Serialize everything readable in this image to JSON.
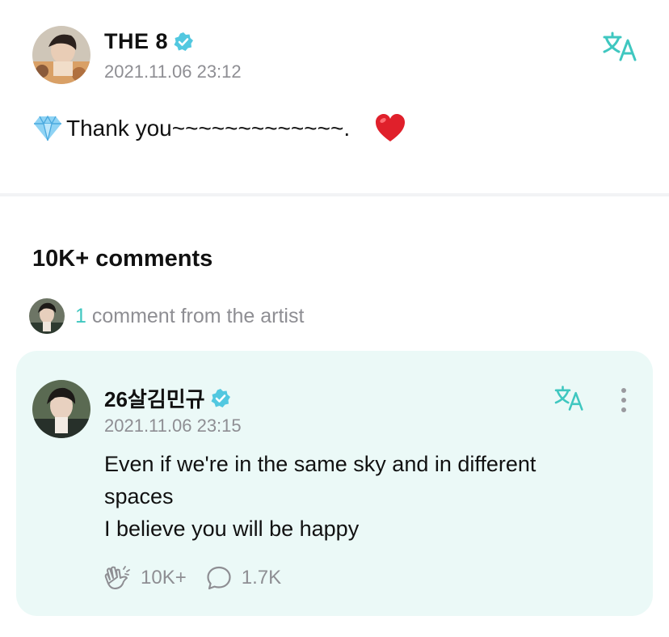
{
  "post": {
    "author": "THE 8",
    "timestamp": "2021.11.06 23:12",
    "text": "Thank you~~~~~~~~~~~~~.",
    "leading_emoji": "gem-stone",
    "trailing_emoji": "red-heart"
  },
  "comments_section": {
    "count_label": "10K+ comments",
    "artist_comment_count": "1",
    "artist_comment_label": " comment from the artist"
  },
  "artist_comment": {
    "author": "26살김민규",
    "timestamp": "2021.11.06 23:15",
    "text_lines": [
      "Even if we're in the same sky and in different",
      "spaces",
      "I believe you will be happy"
    ],
    "likes": "10K+",
    "replies": "1.7K"
  },
  "colors": {
    "accent": "#3fc7c0",
    "card_background": "#ebf9f7",
    "secondary_text": "#8e8e93",
    "verified_badge": "#52c8e0"
  },
  "icons": {
    "verified": "verified-badge-icon",
    "translate": "translate-icon",
    "more": "more-vertical-icon",
    "like": "cheer-hands-icon",
    "reply": "speech-bubble-icon"
  }
}
